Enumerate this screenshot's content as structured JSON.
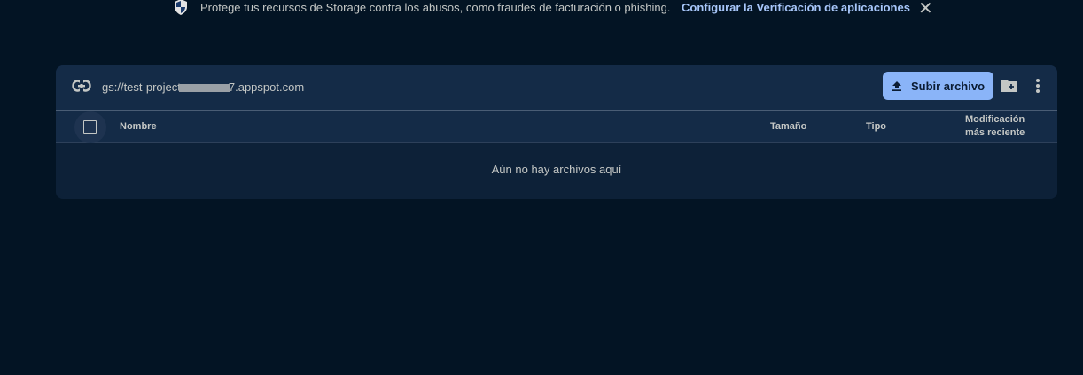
{
  "banner": {
    "message": "Protege tus recursos de Storage contra los abusos, como fraudes de facturación o phishing.",
    "link": "Configurar la Verificación de aplicaciones"
  },
  "toolbar": {
    "path_prefix": "gs://test-project",
    "path_suffix": "7.appspot.com",
    "upload_label": "Subir archivo"
  },
  "table": {
    "columns": [
      "Nombre",
      "Tamaño",
      "Tipo",
      "Modificación",
      "más reciente"
    ],
    "empty_message": "Aún no hay archivos aquí"
  },
  "colors": {
    "background": "#031424",
    "card": "#0d2138",
    "accent": "#8ab4f8",
    "link": "#a8c7fa"
  }
}
